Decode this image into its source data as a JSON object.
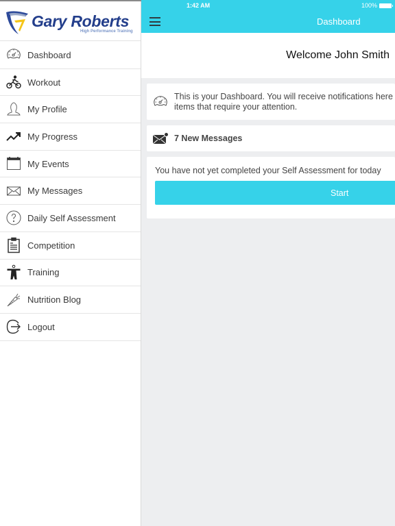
{
  "brand": {
    "name": "Gary Roberts",
    "tagline": "High Performance Training",
    "colors": {
      "primary": "#36d2e9",
      "logo_blue": "#233e8b",
      "logo_yellow": "#f5c518"
    }
  },
  "status_bar": {
    "time": "1:42 AM",
    "battery": "100%"
  },
  "header": {
    "title": "Dashboard",
    "menu_icon": "hamburger-icon"
  },
  "sidebar": {
    "items": [
      {
        "label": "Dashboard",
        "icon": "speedometer-icon"
      },
      {
        "label": "Workout",
        "icon": "cyclist-icon"
      },
      {
        "label": "My Profile",
        "icon": "user-icon"
      },
      {
        "label": "My Progress",
        "icon": "trend-up-icon"
      },
      {
        "label": "My Events",
        "icon": "calendar-icon"
      },
      {
        "label": "My Messages",
        "icon": "envelope-icon"
      },
      {
        "label": "Daily Self Assessment",
        "icon": "question-circle-icon"
      },
      {
        "label": "Competition",
        "icon": "clipboard-icon"
      },
      {
        "label": "Training",
        "icon": "person-icon"
      },
      {
        "label": "Nutrition Blog",
        "icon": "carrot-icon"
      },
      {
        "label": "Logout",
        "icon": "logout-icon"
      }
    ]
  },
  "main": {
    "welcome": "Welcome John Smith",
    "info_line1": "This is your Dashboard. You will receive notifications here if",
    "info_line2": "items that require your attention.",
    "messages": "7 New Messages",
    "assessment_text": "You have not yet completed your Self Assessment for today",
    "start_label": "Start"
  }
}
